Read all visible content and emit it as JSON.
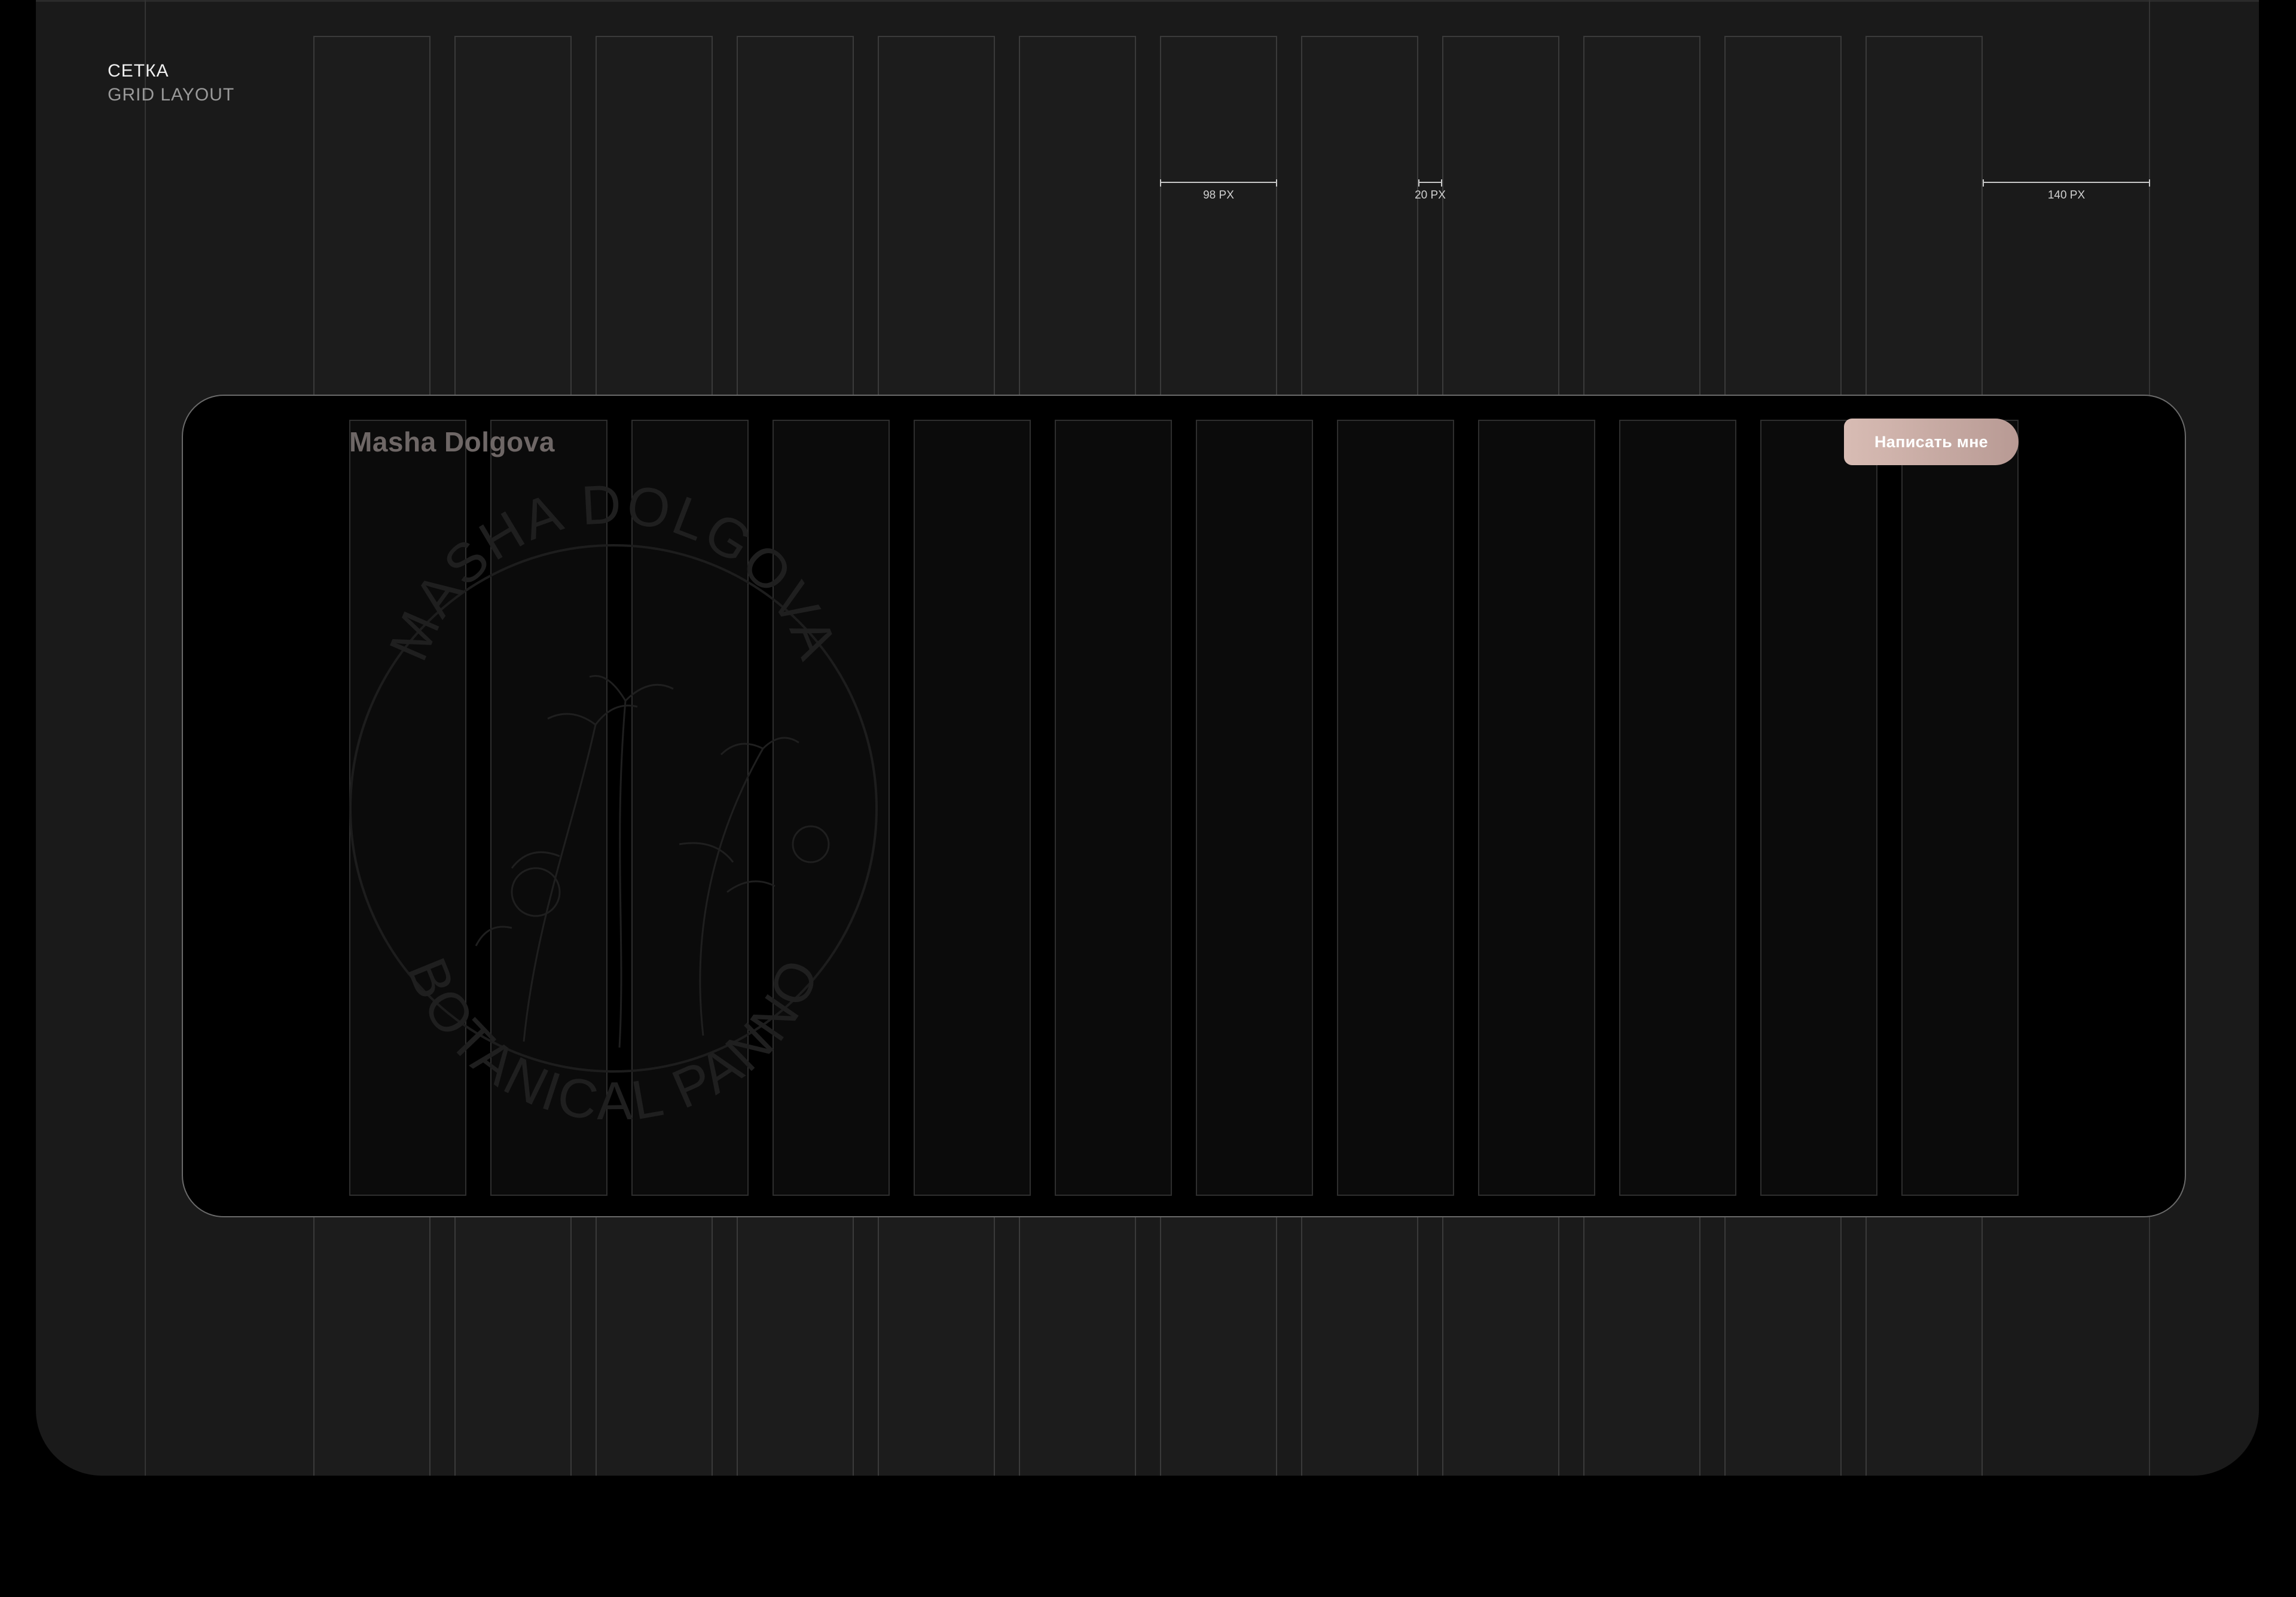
{
  "header": {
    "title": "СЕТКА",
    "subtitle": "GRID LAYOUT"
  },
  "measurements": {
    "column_width_label": "98 PX",
    "gutter_label": "20 PX",
    "margin_label": "140 PX"
  },
  "mockup": {
    "brand": "Masha Dolgova",
    "cta_label": "Написать мне",
    "watermark_top": "MASHA DOLGOVA",
    "watermark_bottom": "BOTANICAL PANNO"
  },
  "colors": {
    "background": "#000000",
    "board": "#1a1a1a",
    "cta_gradient_start": "#d8bcb4",
    "cta_gradient_end": "#b89a94"
  },
  "icons": {
    "watermark": "botanical-seal-icon"
  }
}
